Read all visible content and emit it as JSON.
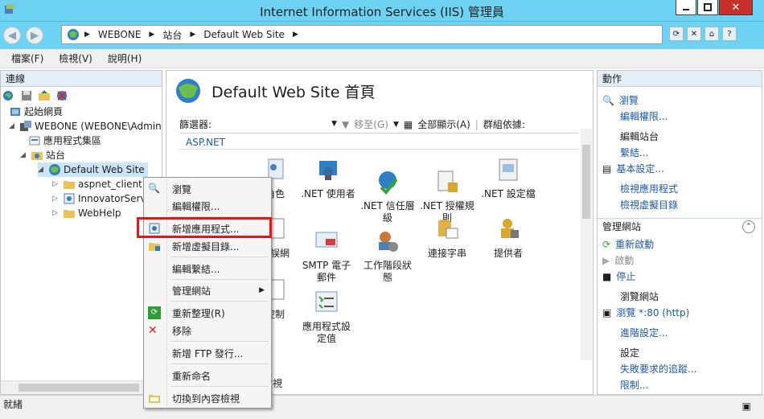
{
  "window": {
    "title": "Internet Information Services (IIS) 管理員"
  },
  "address": {
    "segments": [
      "WEBONE",
      "站台",
      "Default Web Site"
    ]
  },
  "menu": {
    "items": [
      "檔案(F)",
      "檢視(V)",
      "說明(H)"
    ]
  },
  "connections": {
    "title": "連線",
    "tree": [
      {
        "label": "起始網頁"
      },
      {
        "label": "WEBONE (WEBONE\\Admin"
      },
      {
        "label": "應用程式集區"
      },
      {
        "label": "站台"
      },
      {
        "label": "Default Web Site"
      },
      {
        "label": "aspnet_client"
      },
      {
        "label": "InnovatorServ"
      },
      {
        "label": "WebHelp"
      }
    ]
  },
  "center": {
    "heading": "Default Web Site 首頁",
    "filter_label": "篩選器:",
    "go_label": "移至(G)",
    "show_all_label": "全部顯示(A)",
    "group_by_label": "群組依據:",
    "group_name": "ASP.NET",
    "features": [
      {
        "label": "角色"
      },
      {
        "label": ".NET 使用者"
      },
      {
        "label": ".NET 信任層\n級"
      },
      {
        "label": ".NET 授權規\n則"
      },
      {
        "label": ".NET 設定檔"
      },
      {
        "label": "錯誤網"
      },
      {
        "label": "SMTP 電子\n郵件"
      },
      {
        "label": "工作階段狀\n態"
      },
      {
        "label": "連接字串"
      },
      {
        "label": "提供者"
      },
      {
        "label": "控制"
      },
      {
        "label": "應用程式設\n定值"
      }
    ],
    "view_tab_partial": "檢視"
  },
  "actions": {
    "title": "動作",
    "browse": "瀏覽",
    "edit_permissions": "編輯權限...",
    "edit_site_header": "編輯站台",
    "bindings": "繫結...",
    "basic_settings": "基本設定...",
    "view_applications": "檢視應用程式",
    "view_virtual_dirs": "檢視虛擬目錄",
    "manage_site_header": "管理網站",
    "restart": "重新啟動",
    "start": "啟動",
    "stop": "停止",
    "browse_site_header": "瀏覽網站",
    "browse_port": "瀏覽 *:80 (http)",
    "advanced_settings": "進階設定...",
    "configure_header": "設定",
    "failed_request_tracing": "失敗要求的追蹤...",
    "limits": "限制..."
  },
  "context_menu": {
    "items": [
      {
        "label": "瀏覽"
      },
      {
        "label": "編輯權限..."
      },
      {
        "label": "新增應用程式..."
      },
      {
        "label": "新增虛擬目錄..."
      },
      {
        "label": "編輯繫結..."
      },
      {
        "label": "管理網站"
      },
      {
        "label": "重新整理(R)"
      },
      {
        "label": "移除"
      },
      {
        "label": "新增 FTP 發行..."
      },
      {
        "label": "重新命名"
      },
      {
        "label": "切換到內容檢視"
      }
    ]
  },
  "status": {
    "text": "就緒"
  },
  "colors": {
    "titlebar": "#6ed3f2",
    "link": "#1f5aa5",
    "highlight": "#e8141c"
  }
}
